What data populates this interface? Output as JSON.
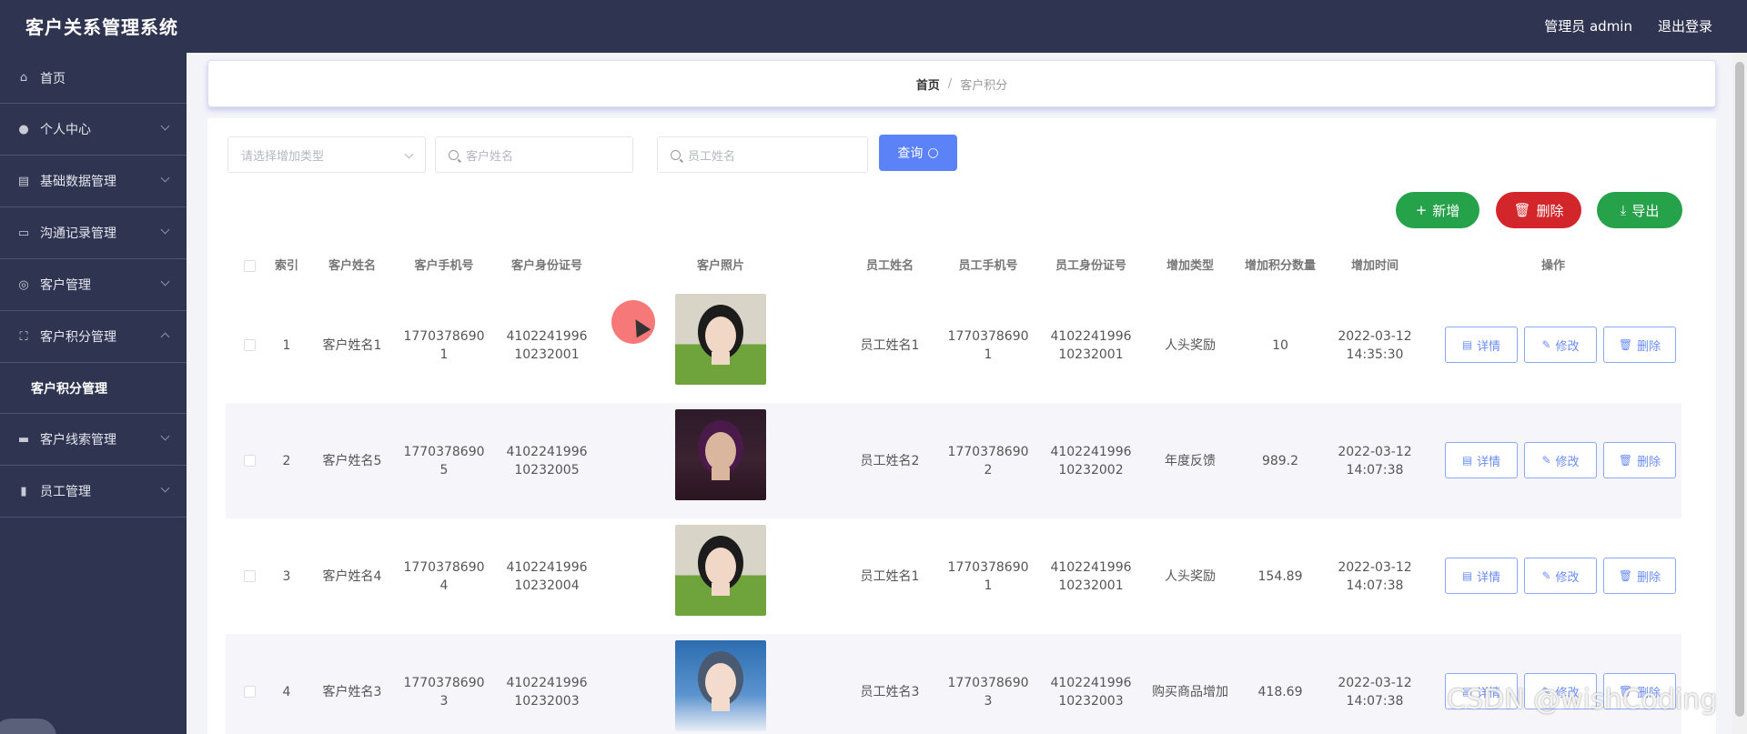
{
  "header": {
    "title": "客户关系管理系统",
    "user": "管理员 admin",
    "logout": "退出登录"
  },
  "sidebar": {
    "items": [
      {
        "label": "首页",
        "icon": "home-icon"
      },
      {
        "label": "个人中心",
        "icon": "user-icon"
      },
      {
        "label": "基础数据管理",
        "icon": "data-icon"
      },
      {
        "label": "沟通记录管理",
        "icon": "record-icon"
      },
      {
        "label": "客户管理",
        "icon": "globe-icon"
      },
      {
        "label": "客户积分管理",
        "icon": "frame-icon",
        "sub": "客户积分管理"
      },
      {
        "label": "客户线索管理",
        "icon": "chat-icon"
      },
      {
        "label": "员工管理",
        "icon": "staff-icon"
      }
    ]
  },
  "breadcrumb": {
    "home": "首页",
    "sep": "/",
    "current": "客户积分"
  },
  "filters": {
    "type_placeholder": "请选择增加类型",
    "customer_placeholder": "客户姓名",
    "staff_placeholder": "员工姓名",
    "search_label": "查询"
  },
  "actions": {
    "add": "新增",
    "delete": "删除",
    "export": "导出"
  },
  "table": {
    "headers": [
      "索引",
      "客户姓名",
      "客户手机号",
      "客户身份证号",
      "客户照片",
      "员工姓名",
      "员工手机号",
      "员工身份证号",
      "增加类型",
      "增加积分数量",
      "增加时间",
      "操作"
    ],
    "op_labels": {
      "detail": "详情",
      "edit": "修改",
      "delete": "删除"
    },
    "rows": [
      {
        "index": "1",
        "cname": "客户姓名1",
        "cphone1": "1770378690",
        "cphone2": "1",
        "cid1": "4102241996",
        "cid2": "10232001",
        "sname": "员工姓名1",
        "sphone1": "1770378690",
        "sphone2": "1",
        "sid1": "4102241996",
        "sid2": "10232001",
        "type": "人头奖励",
        "points": "10",
        "date": "2022-03-12",
        "time": "14:35:30"
      },
      {
        "index": "2",
        "cname": "客户姓名5",
        "cphone1": "1770378690",
        "cphone2": "5",
        "cid1": "4102241996",
        "cid2": "10232005",
        "sname": "员工姓名2",
        "sphone1": "1770378690",
        "sphone2": "2",
        "sid1": "4102241996",
        "sid2": "10232002",
        "type": "年度反馈",
        "points": "989.2",
        "date": "2022-03-12",
        "time": "14:07:38"
      },
      {
        "index": "3",
        "cname": "客户姓名4",
        "cphone1": "1770378690",
        "cphone2": "4",
        "cid1": "4102241996",
        "cid2": "10232004",
        "sname": "员工姓名1",
        "sphone1": "1770378690",
        "sphone2": "1",
        "sid1": "4102241996",
        "sid2": "10232001",
        "type": "人头奖励",
        "points": "154.89",
        "date": "2022-03-12",
        "time": "14:07:38"
      },
      {
        "index": "4",
        "cname": "客户姓名3",
        "cphone1": "1770378690",
        "cphone2": "3",
        "cid1": "4102241996",
        "cid2": "10232003",
        "sname": "员工姓名3",
        "sphone1": "1770378690",
        "sphone2": "3",
        "sid1": "4102241996",
        "sid2": "10232003",
        "type": "购买商品增加",
        "points": "418.69",
        "date": "2022-03-12",
        "time": "14:07:38"
      }
    ]
  },
  "watermark": "CSDN @wishCoding",
  "colors": {
    "sidebar_bg": "#2f3551",
    "primary": "#5b82f6",
    "success": "#25a24a",
    "danger": "#d3262b"
  }
}
